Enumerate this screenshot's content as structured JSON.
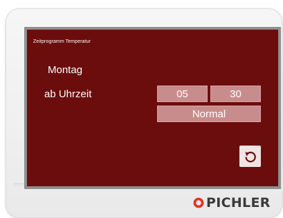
{
  "screen": {
    "title": "Zeitprogramm Temperatur",
    "day": "Montag",
    "time_label": "ab Uhrzeit",
    "hour": "05",
    "minute": "30",
    "mode": "Normal",
    "reset_icon": "undo-icon"
  },
  "brand": {
    "name": "PICHLER",
    "logo_icon": "ring-logo-icon",
    "logo_color": "#e53224"
  },
  "colors": {
    "screen_background": "#6c0d0d",
    "field_background": "#c98c8c",
    "reset_button_background": "#f2e4e4",
    "text": "#ffffff"
  }
}
